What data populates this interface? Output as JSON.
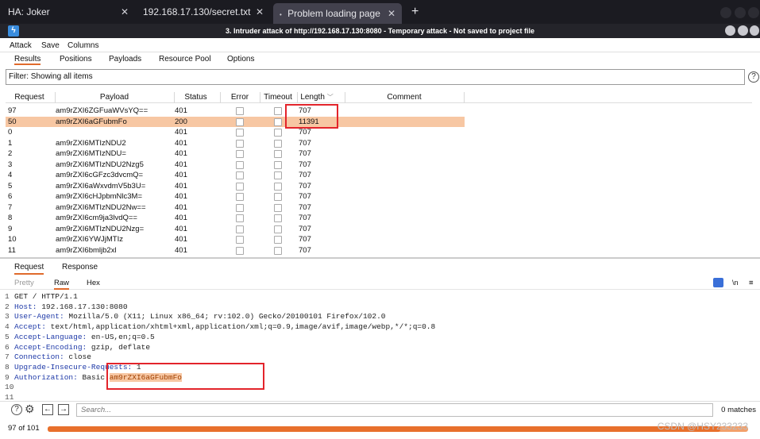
{
  "browser": {
    "tabs": [
      {
        "title": "HA: Joker"
      },
      {
        "title": "192.168.17.130/secret.txt"
      },
      {
        "title": "Problem loading page"
      }
    ],
    "new_tab": "+"
  },
  "window": {
    "title": "3. Intruder attack of http://192.168.17.130:8080 - Temporary attack - Not saved to project file"
  },
  "menu": {
    "items": [
      "Attack",
      "Save",
      "Columns"
    ]
  },
  "subtabs": {
    "items": [
      "Results",
      "Positions",
      "Payloads",
      "Resource Pool",
      "Options"
    ],
    "selected": "Results"
  },
  "filter": {
    "text": "Filter: Showing all items"
  },
  "table": {
    "columns": [
      "Request",
      "Payload",
      "Status",
      "Error",
      "Timeout",
      "Length",
      "Comment"
    ],
    "rows": [
      {
        "request": "97",
        "payload": "am9rZXI6ZGFuaWVsYQ==",
        "status": "401",
        "length": "707"
      },
      {
        "request": "50",
        "payload": "am9rZXI6aGFubmFo",
        "status": "200",
        "length": "11391"
      },
      {
        "request": "0",
        "payload": "",
        "status": "401",
        "length": "707"
      },
      {
        "request": "1",
        "payload": "am9rZXI6MTIzNDU2",
        "status": "401",
        "length": "707"
      },
      {
        "request": "2",
        "payload": "am9rZXI6MTIzNDU=",
        "status": "401",
        "length": "707"
      },
      {
        "request": "3",
        "payload": "am9rZXI6MTIzNDU2Nzg5",
        "status": "401",
        "length": "707"
      },
      {
        "request": "4",
        "payload": "am9rZXI6cGFzc3dvcmQ=",
        "status": "401",
        "length": "707"
      },
      {
        "request": "5",
        "payload": "am9rZXI6aWxvdmV5b3U=",
        "status": "401",
        "length": "707"
      },
      {
        "request": "6",
        "payload": "am9rZXI6cHJpbmNlc3M=",
        "status": "401",
        "length": "707"
      },
      {
        "request": "7",
        "payload": "am9rZXI6MTIzNDU2Nw==",
        "status": "401",
        "length": "707"
      },
      {
        "request": "8",
        "payload": "am9rZXI6cm9ja3lvdQ==",
        "status": "401",
        "length": "707"
      },
      {
        "request": "9",
        "payload": "am9rZXI6MTIzNDU2Nzg=",
        "status": "401",
        "length": "707"
      },
      {
        "request": "10",
        "payload": "am9rZXI6YWJjMTIz",
        "status": "401",
        "length": "707"
      },
      {
        "request": "11",
        "payload": "am9rZXI6bmljb2xl",
        "status": "401",
        "length": "707"
      }
    ]
  },
  "detail": {
    "tabs": [
      "Request",
      "Response"
    ],
    "views": [
      "Pretty",
      "Raw",
      "Hex"
    ],
    "newline_toggle": "\\n",
    "lines": [
      {
        "num": "1",
        "key": "",
        "value": "GET / HTTP/1.1"
      },
      {
        "num": "2",
        "key": "Host:",
        "value": " 192.168.17.130:8080"
      },
      {
        "num": "3",
        "key": "User-Agent:",
        "value": " Mozilla/5.0 (X11; Linux x86_64; rv:102.0) Gecko/20100101 Firefox/102.0"
      },
      {
        "num": "4",
        "key": "Accept:",
        "value": " text/html,application/xhtml+xml,application/xml;q=0.9,image/avif,image/webp,*/*;q=0.8"
      },
      {
        "num": "5",
        "key": "Accept-Language:",
        "value": " en-US,en;q=0.5"
      },
      {
        "num": "6",
        "key": "Accept-Encoding:",
        "value": " gzip, deflate"
      },
      {
        "num": "7",
        "key": "Connection:",
        "value": " close"
      },
      {
        "num": "8",
        "key": "Upgrade-Insecure-Requests:",
        "value": " 1"
      },
      {
        "num": "9",
        "key": "Authorization:",
        "value": " Basic ",
        "highlight": "am9rZXI6aGFubmFo"
      },
      {
        "num": "10",
        "key": "",
        "value": ""
      },
      {
        "num": "11",
        "key": "",
        "value": ""
      }
    ]
  },
  "search": {
    "placeholder": "Search...",
    "matches": "0 matches"
  },
  "status": {
    "count": "97 of 101",
    "progress": 0.96
  },
  "watermark": "CSDN @HSY233233",
  "colors": {
    "accent": "#e06a2c",
    "selected_row": "#f7c7a3",
    "highlight_box": "#e3242b"
  }
}
